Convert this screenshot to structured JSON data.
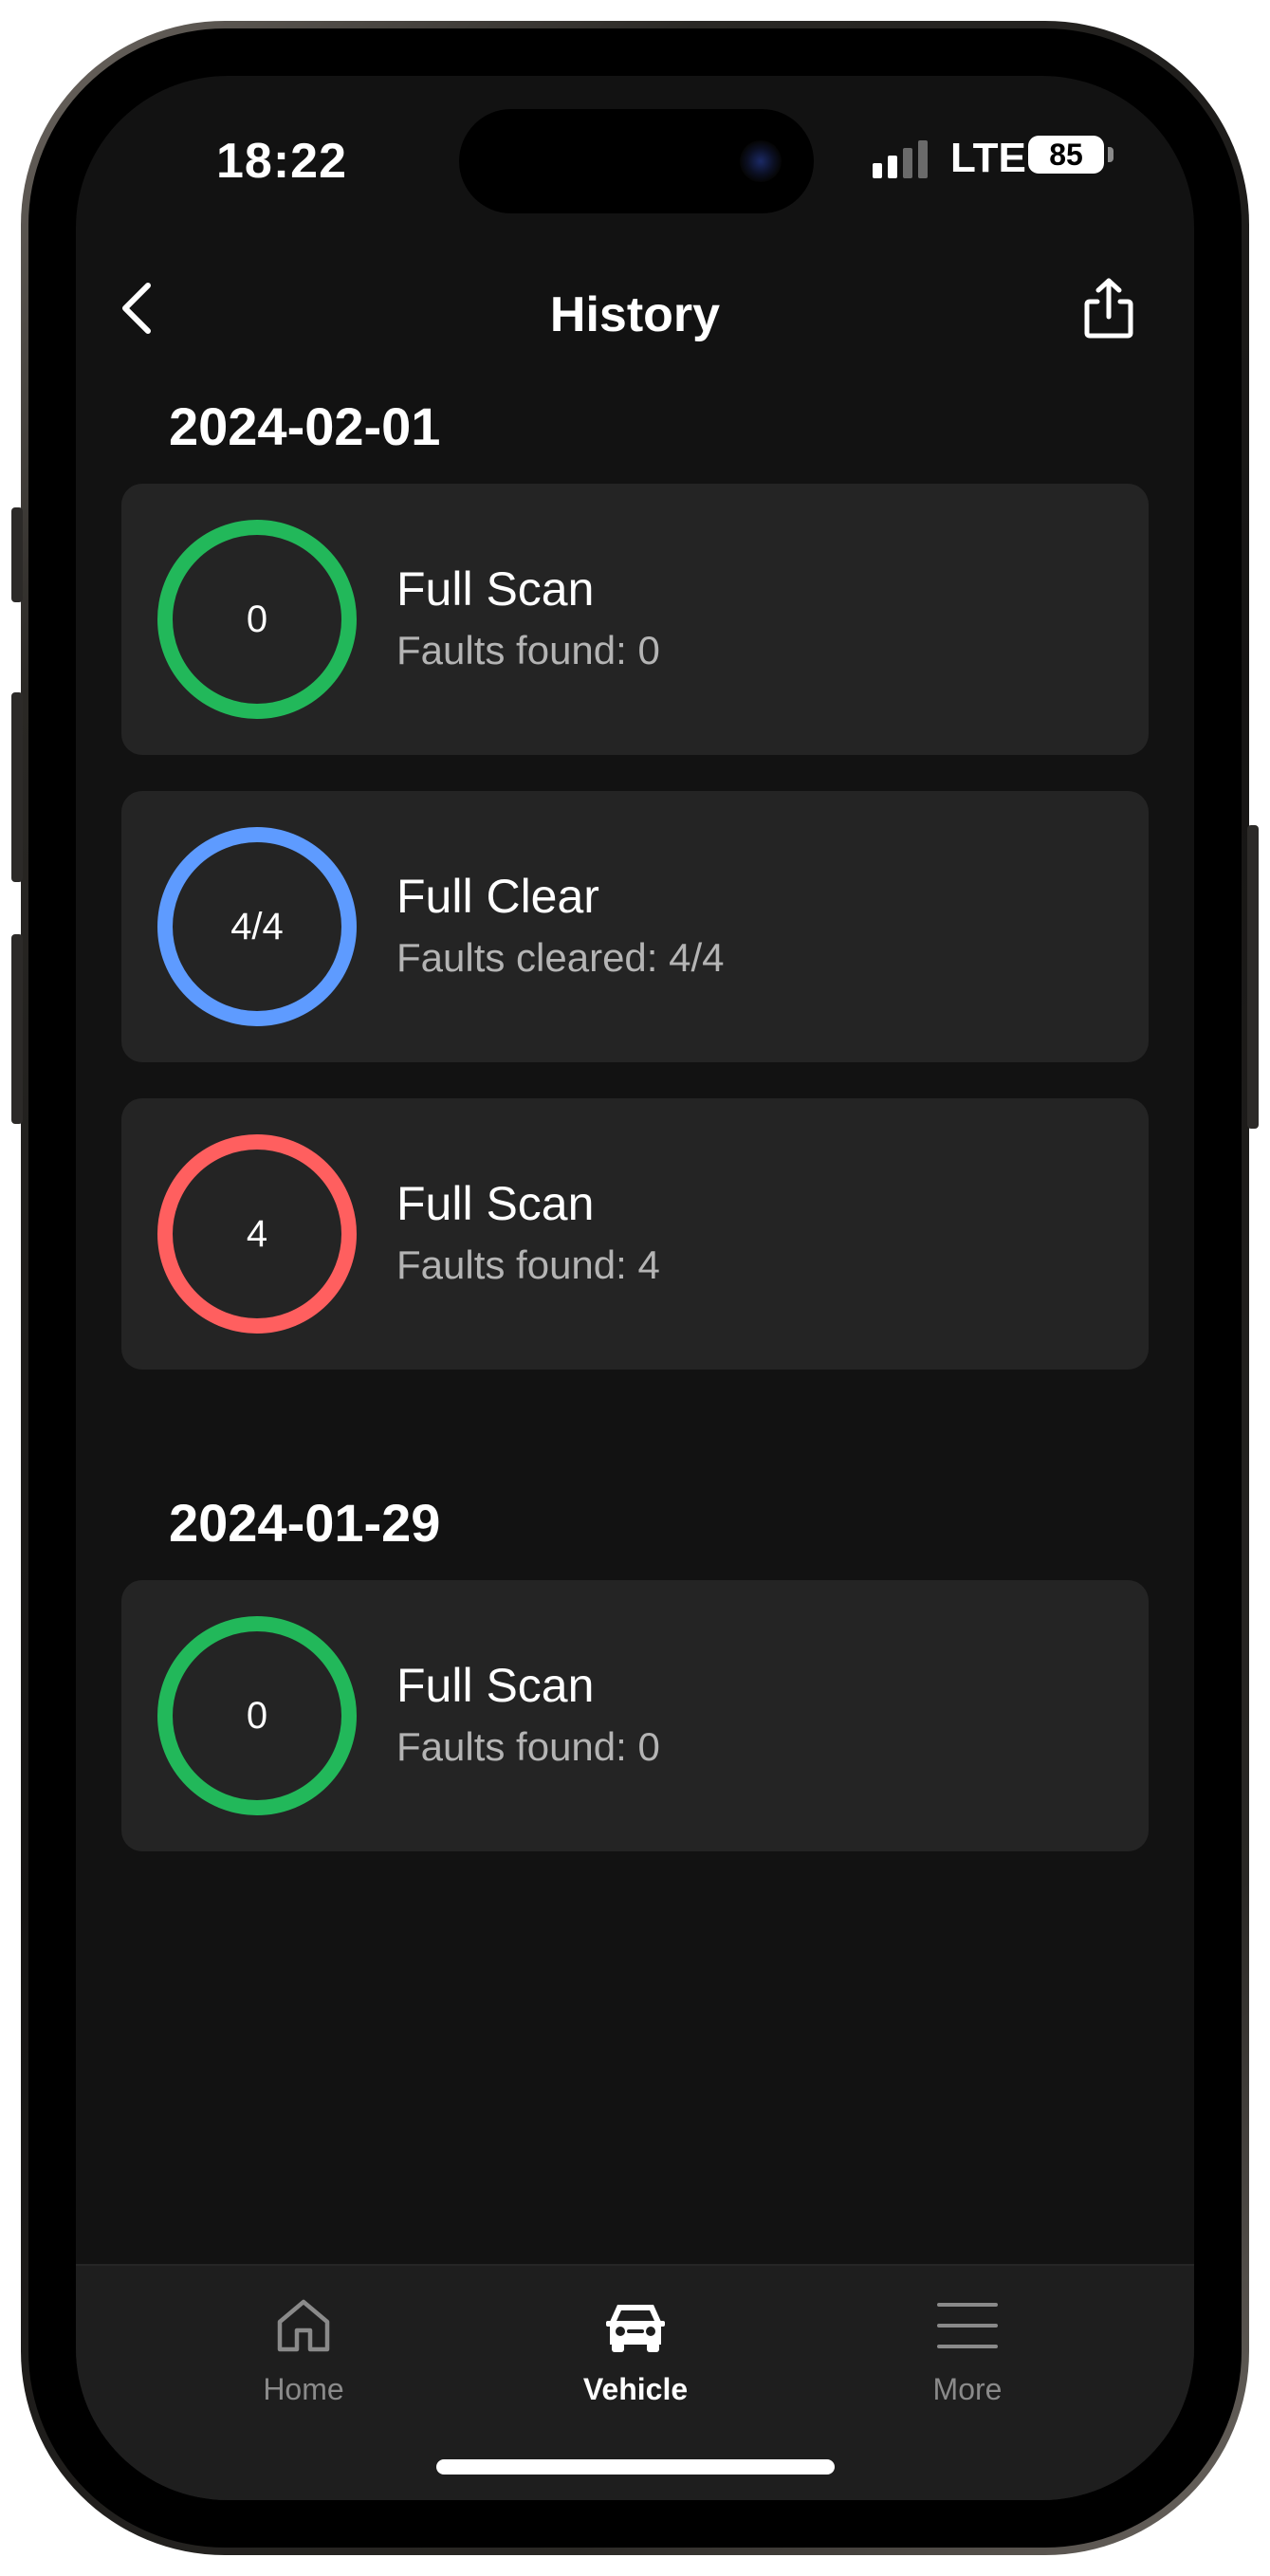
{
  "status_bar": {
    "time": "18:22",
    "network": "LTE",
    "battery": "85"
  },
  "header": {
    "title": "History",
    "back_icon": "chevron-left-icon",
    "share_icon": "share-icon"
  },
  "groups": [
    {
      "date": "2024-02-01",
      "entries": [
        {
          "ring_value": "0",
          "title": "Full Scan",
          "subtitle": "Faults found: 0",
          "status_color": "#22b85a"
        },
        {
          "ring_value": "4/4",
          "title": "Full Clear",
          "subtitle": "Faults cleared: 4/4",
          "status_color": "#5e9bff"
        },
        {
          "ring_value": "4",
          "title": "Full Scan",
          "subtitle": "Faults found: 4",
          "status_color": "#ff5f5f"
        }
      ]
    },
    {
      "date": "2024-01-29",
      "entries": [
        {
          "ring_value": "0",
          "title": "Full Scan",
          "subtitle": "Faults found: 0",
          "status_color": "#22b85a"
        }
      ]
    }
  ],
  "tab_bar": {
    "tabs": [
      {
        "label": "Home",
        "icon": "home-icon",
        "active": false
      },
      {
        "label": "Vehicle",
        "icon": "car-icon",
        "active": true
      },
      {
        "label": "More",
        "icon": "menu-icon",
        "active": false
      }
    ]
  },
  "colors": {
    "background": "#121212",
    "card": "#242424",
    "ok": "#22b85a",
    "cleared": "#5e9bff",
    "fault": "#ff5f5f"
  }
}
